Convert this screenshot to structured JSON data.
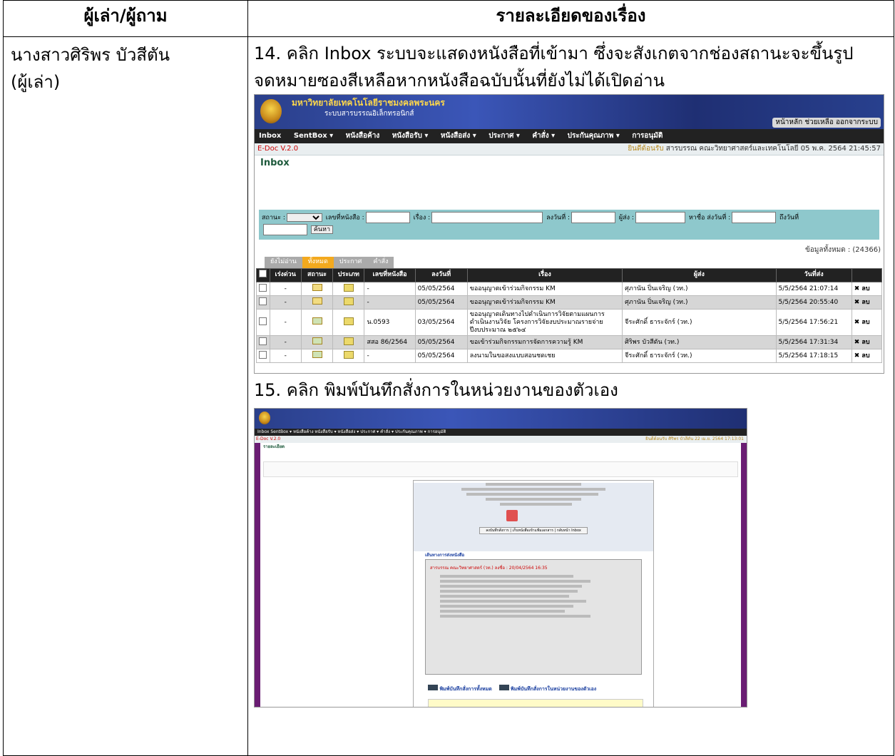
{
  "header": {
    "col1": "ผู้เล่า/ผู้ถาม",
    "col2": "รายละเอียดของเรื่อง"
  },
  "narrator": {
    "name": "นางสาวศิริพร  บัวสีตัน",
    "role": "(ผู้เล่า)"
  },
  "steps": [
    {
      "text": "14. คลิก Inbox ระบบจะแสดงหนังสือที่เข้ามา ซึ่งจะสังเกตจากช่องสถานะจะขึ้นรูปจดหมายซองสีเหลือหากหนังสือฉบับนั้นที่ยังไม่ได้เปิดอ่าน"
    },
    {
      "text": "15. คลิก พิมพ์บันทึกสั่งการในหน่วยงานของตัวเอง"
    }
  ],
  "shot1": {
    "university": "มหาวิทยาลัยเทคโนโลยีราชมงคลพระนคร",
    "system": "ระบบสารบรรณอิเล็กทรอนิกส์",
    "toplinks": "หน้าหลัก   ช่วยเหลือ   ออกจากระบบ",
    "menu": [
      "Inbox",
      "SentBox ▾",
      "หนังสือค้าง",
      "หนังสือรับ ▾",
      "หนังสือส่ง ▾",
      "ประกาศ ▾",
      "คำสั่ง ▾",
      "ประกันคุณภาพ ▾",
      "การอนุมัติ"
    ],
    "version": "E-Doc V.2.0",
    "welcome_label": "ยินดีต้อนรับ",
    "welcome_text": "สารบรรณ คณะวิทยาศาสตร์และเทคโนโลยี 05 พ.ค. 2564 21:45:57",
    "title": "Inbox",
    "filter": {
      "status": "สถานะ :",
      "docno": "เลขที่หนังสือ :",
      "subject": "เรื่อง :",
      "date": "ลงวันที่ :",
      "sender": "ผู้ส่ง :",
      "findname": "หาชื่อ",
      "sentdate": "ส่งวันที่ :",
      "sentdate2": "ถึงวันที่",
      "search": "ค้นหา"
    },
    "total": "ข้อมูลทั้งหมด : (24366)",
    "tabs": [
      "ยังไม่อ่าน",
      "ทั้งหมด",
      "ประกาศ",
      "คำสั่ง"
    ],
    "columns": [
      "",
      "เร่งด่วน",
      "สถานะ",
      "ประเภท",
      "เลขที่หนังสือ",
      "ลงวันที่",
      "เรื่อง",
      "ผู้ส่ง",
      "วันที่ส่ง",
      ""
    ],
    "rows": [
      {
        "urgent": "-",
        "docno": "-",
        "date": "05/05/2564",
        "subject": "ขออนุญาตเข้าร่วมกิจกรรม KM",
        "sender": "ศุภานัน ปิ่นเจริญ (วท.)",
        "sent": "5/5/2564 21:07:14",
        "act": "ลบ"
      },
      {
        "urgent": "-",
        "docno": "-",
        "date": "05/05/2564",
        "subject": "ขออนุญาตเข้าร่วมกิจกรรม KM",
        "sender": "ศุภานัน ปิ่นเจริญ (วท.)",
        "sent": "5/5/2564 20:55:40",
        "act": "ลบ"
      },
      {
        "urgent": "-",
        "docno": "น.0593",
        "date": "03/05/2564",
        "subject": "ขออนุญาตเดินทางไปดำเนินการวิจัยตามแผนการดำเนินงานวิจัย โครงการวิจัยงบประมาณรายจ่าย ปีงบประมาณ ๒๕๖๔",
        "sender": "จีระศักดิ์ ธาระจักร์ (วท.)",
        "sent": "5/5/2564 17:56:21",
        "act": "ลบ"
      },
      {
        "urgent": "-",
        "docno": "สสอ 86/2564",
        "date": "05/05/2564",
        "subject": "ขอเข้าร่วมกิจกรรมการจัดการความรู้ KM",
        "sender": "ศิริพร บัวสีตัน (วท.)",
        "sent": "5/5/2564 17:31:34",
        "act": "ลบ"
      },
      {
        "urgent": "-",
        "docno": "-",
        "date": "05/05/2564",
        "subject": "ลงนามในขอสงแบบสอนชดเชย",
        "sender": "จีระศักดิ์ ธาระจักร์ (วท.)",
        "sent": "5/5/2564 17:18:15",
        "act": "ลบ"
      }
    ]
  },
  "shot2": {
    "version": "E-Doc V.2.0",
    "page_title": "รายละเอียด",
    "menu": "Inbox   SentBox ▾   หนังสือค้าง   หนังสือรับ ▾   หนังสือส่ง ▾   ประกาศ ▾   คำสั่ง ▾   ประกันคุณภาพ ▾   การอนุมัติ",
    "welcome": "ยินดีต้อนรับ ศิริพร บัวสีตัน 22 เม.ย. 2564 17:13:01",
    "buttons": "ลงบันทึกสั่งการ | เก็บหนังสือเข้าแฟ้มเอกสาร | กลับหน้า Inbox",
    "routing_title": "เส้นทางการส่งหนังสือ",
    "routing_head": "สารบรรณ คณะวิทยาศาสตร์ (วท.) ลงชื่อ : 20/04/2564 16:35",
    "print_all": "พิมพ์บันทึกสั่งการทั้งหมด",
    "print_own": "พิมพ์บันทึกสั่งการในหน่วยงานของตัวเอง"
  }
}
